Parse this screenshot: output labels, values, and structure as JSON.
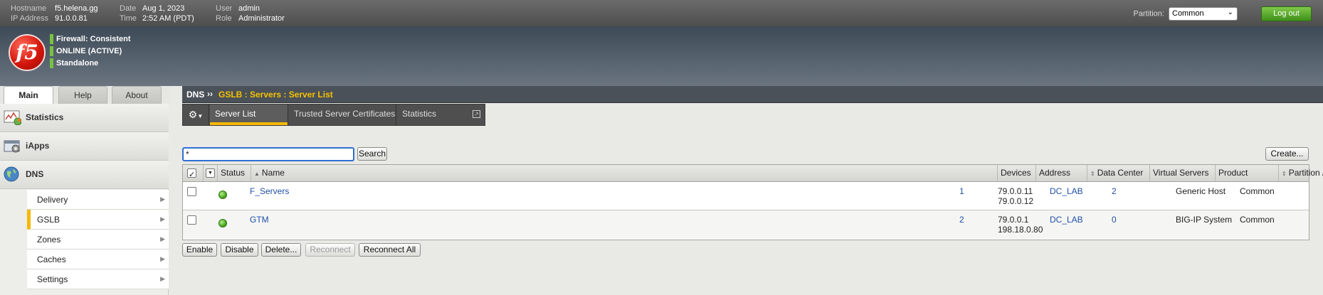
{
  "header": {
    "hostname_label": "Hostname",
    "hostname": "f5.helena.gg",
    "ip_label": "IP Address",
    "ip": "91.0.0.81",
    "date_label": "Date",
    "date": "Aug 1, 2023",
    "time_label": "Time",
    "time": "2:52 AM (PDT)",
    "user_label": "User",
    "user": "admin",
    "role_label": "Role",
    "role": "Administrator",
    "partition_label": "Partition:",
    "partition_value": "Common",
    "logout_label": "Log out"
  },
  "logo": {
    "text": "f5"
  },
  "status": {
    "lines": [
      "Firewall: Consistent",
      "ONLINE (ACTIVE)",
      "Standalone"
    ],
    "indicator_color": "#79c142"
  },
  "left_tabs": [
    "Main",
    "Help",
    "About"
  ],
  "left_nav": {
    "groups": [
      "Statistics",
      "iApps",
      "DNS"
    ],
    "dns_items": [
      "Delivery",
      "GSLB",
      "Zones",
      "Caches",
      "Settings"
    ]
  },
  "breadcrumb": {
    "root": "DNS",
    "separator": "››",
    "path": "GSLB : Servers : Server List"
  },
  "sub_tabs": [
    "Server List",
    "Trusted Server Certificates",
    "Statistics"
  ],
  "search": {
    "value": "*",
    "button": "Search"
  },
  "create_button": "Create...",
  "table": {
    "columns": [
      "Status",
      "Name",
      "Devices",
      "Address",
      "Data Center",
      "Virtual Servers",
      "Product",
      "Partition / Path"
    ],
    "rows": [
      {
        "name": "F_Servers",
        "devices": "1",
        "address1": "79.0.0.11",
        "address2": "79.0.0.12",
        "data_center": "DC_LAB",
        "virtual_servers": "2",
        "product": "Generic Host",
        "partition": "Common",
        "status": "green"
      },
      {
        "name": "GTM",
        "devices": "2",
        "address1": "79.0.0.1",
        "address2": "198.18.0.80",
        "data_center": "DC_LAB",
        "virtual_servers": "0",
        "product": "BIG-IP System",
        "partition": "Common",
        "status": "green"
      }
    ]
  },
  "action_buttons": [
    "Enable",
    "Disable",
    "Delete...",
    "Reconnect",
    "Reconnect All"
  ],
  "colors": {
    "accent": "#f5b800",
    "link": "#1f4fa8",
    "logout": "#4fa326"
  }
}
